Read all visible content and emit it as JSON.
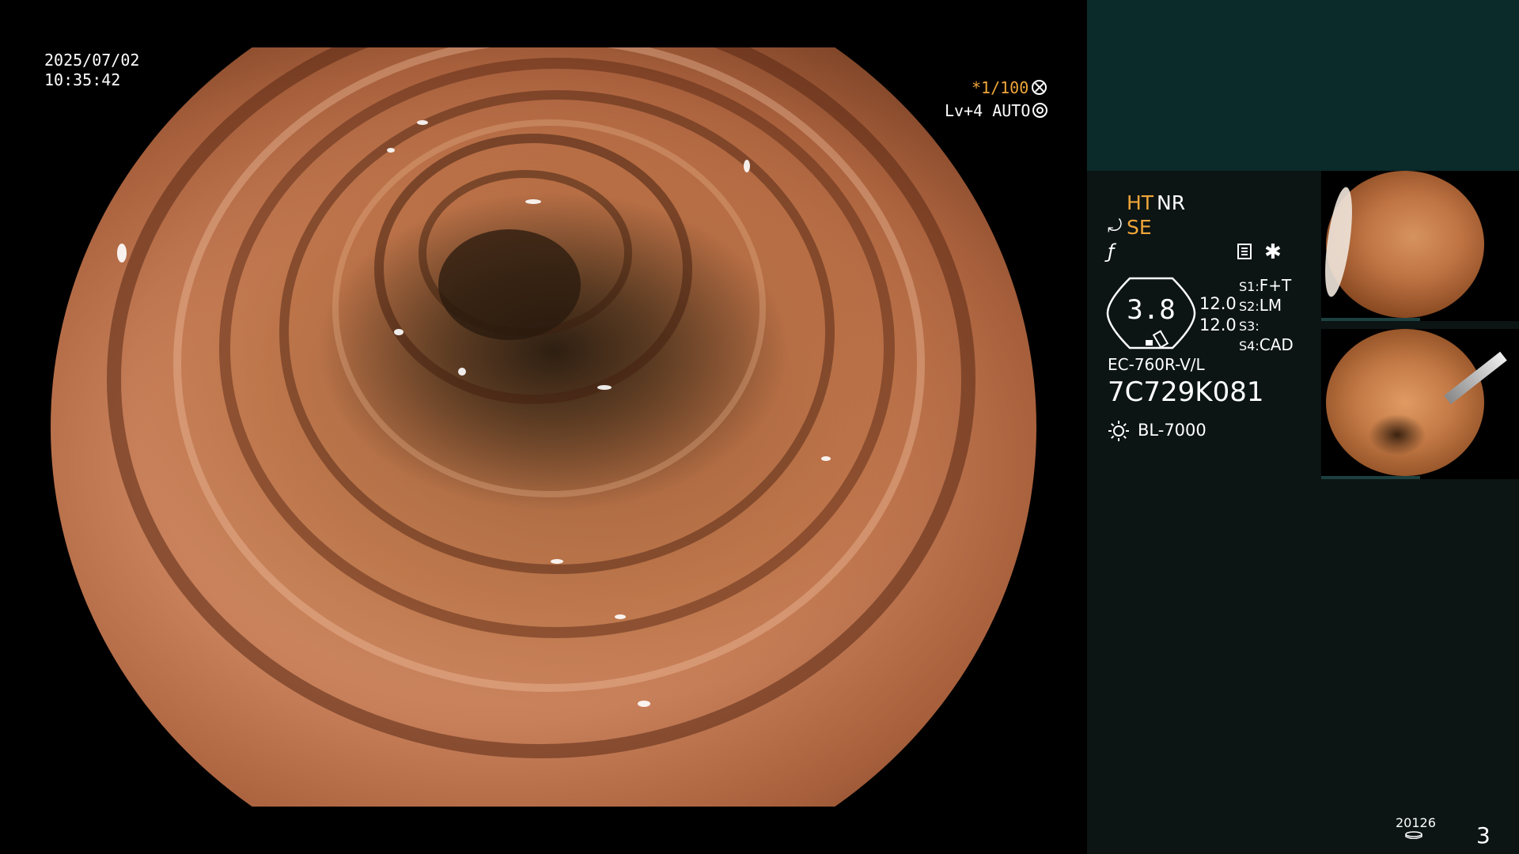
{
  "osd": {
    "date": "2025/07/02",
    "time": "10:35:42",
    "shutter": "*1/100",
    "level": "Lv+4 AUTO"
  },
  "settings": {
    "ht": "HT",
    "nr": "NR",
    "se": "SE",
    "gauge_value": "3.8",
    "value_1": "12.0",
    "value_2": "12.0",
    "switches": [
      {
        "key": "S1:",
        "value": "F+T"
      },
      {
        "key": "S2:",
        "value": "LM"
      },
      {
        "key": "S3:",
        "value": ""
      },
      {
        "key": "S4:",
        "value": "CAD"
      }
    ],
    "scope_model": "EC-760R-V/L",
    "scope_serial": "7C729K081",
    "light_source": "BL-7000"
  },
  "footer": {
    "counter": "20126",
    "page": "3"
  },
  "icons": [
    "shutter-icon",
    "auto-icon",
    "se-icon",
    "f-icon",
    "menu-icon",
    "star-icon",
    "gauge-icon",
    "sun-icon",
    "disk-icon"
  ]
}
